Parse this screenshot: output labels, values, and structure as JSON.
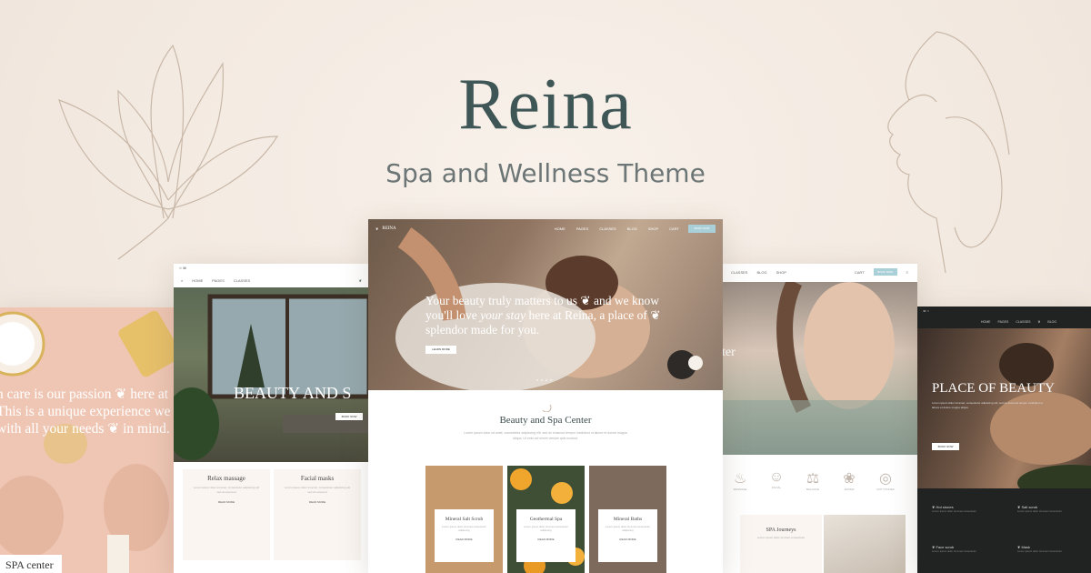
{
  "brand": {
    "title": "Reina",
    "subtitle": "Spa and Wellness Theme"
  },
  "card_left": {
    "paragraph": "n care is our passion ❦ here at\nThis is a unique experience we\nwith all your needs ❦ in mind.",
    "badge": "SPA center"
  },
  "card_left_mid": {
    "hero_heading": "BEAUTY AND S",
    "hero_button": "BOOK NOW",
    "services": [
      {
        "title": "Relax massage",
        "desc": "Lorem ipsum dolor sit amet, consectetur adipiscing elit sed do eiusmod",
        "link": "READ MORE"
      },
      {
        "title": "Facial masks",
        "desc": "Lorem ipsum dolor sit amet, consectetur adipiscing elit sed do eiusmod",
        "link": "READ MORE"
      }
    ]
  },
  "card_center": {
    "logo": "REINA",
    "nav": [
      "HOME",
      "PAGES",
      "CLASSES",
      "BLOG",
      "SHOP"
    ],
    "cart": "CART",
    "book_button": "BOOK NOW",
    "hero_text_1": "Your beauty truly matters to us ❦ and we know you'll love ",
    "hero_text_em": "your stay",
    "hero_text_2": " here at Reina, a place of ❦ splendor made for you.",
    "hero_button": "LEARN MORE",
    "section_title": "Beauty and Spa Center",
    "section_desc": "Lorem ipsum dolor sit amet, consectetur adipiscing elit, sed do eiusmod tempor incididunt ut labore et dolore magna aliqua. Ut enim ad minim veniam quis nostrud.",
    "tiles": [
      {
        "title": "Mineral Salt Scrub",
        "desc": "Lorem ipsum dolor sit amet consectetur adipiscing",
        "link": "READ MORE",
        "bg": "#c79a6d"
      },
      {
        "title": "Geothermal Spa",
        "desc": "Lorem ipsum dolor sit amet consectetur adipiscing",
        "link": "READ MORE",
        "bg": "#e08a2a"
      },
      {
        "title": "Mineral Baths",
        "desc": "Lorem ipsum dolor sit amet consectetur adipiscing",
        "link": "READ MORE",
        "bg": "#7d6a5d"
      }
    ]
  },
  "card_right_mid": {
    "nav": [
      "CLASSES",
      "BLOG",
      "SHOP"
    ],
    "cart": "CART",
    "book_button": "BOOK NOW",
    "hero_fragment": "ter",
    "icon_labels": [
      "MASSAGE",
      "FACIAL",
      "BALANCE",
      "AROMA",
      "HOT STONES"
    ],
    "journey_title": "SPA Journeys",
    "journey_desc": "Lorem ipsum dolor sit amet consectetur"
  },
  "card_right": {
    "nav": [
      "HOME",
      "PAGES",
      "CLASSES",
      "BLOG"
    ],
    "hero_heading": "PLACE OF BEAUTY",
    "hero_desc": "Lorem ipsum dolor sit amet, consectetur adipiscing elit, sed do eiusmod tempor incididunt ut labore et dolore magna aliqua.",
    "hero_button": "BOOK NOW",
    "list": [
      {
        "title": "Hot stones",
        "desc": "Lorem ipsum dolor sit amet consectetur"
      },
      {
        "title": "Salt scrub",
        "desc": "Lorem ipsum dolor sit amet consectetur"
      },
      {
        "title": "Face scrub",
        "desc": "Lorem ipsum dolor sit amet consectetur"
      },
      {
        "title": "Mask",
        "desc": "Lorem ipsum dolor sit amet consectetur"
      }
    ]
  },
  "colors": {
    "accent": "#a9cfd8",
    "title": "#3e5656",
    "background": "#f5ede6",
    "dark_card": "#202322"
  }
}
